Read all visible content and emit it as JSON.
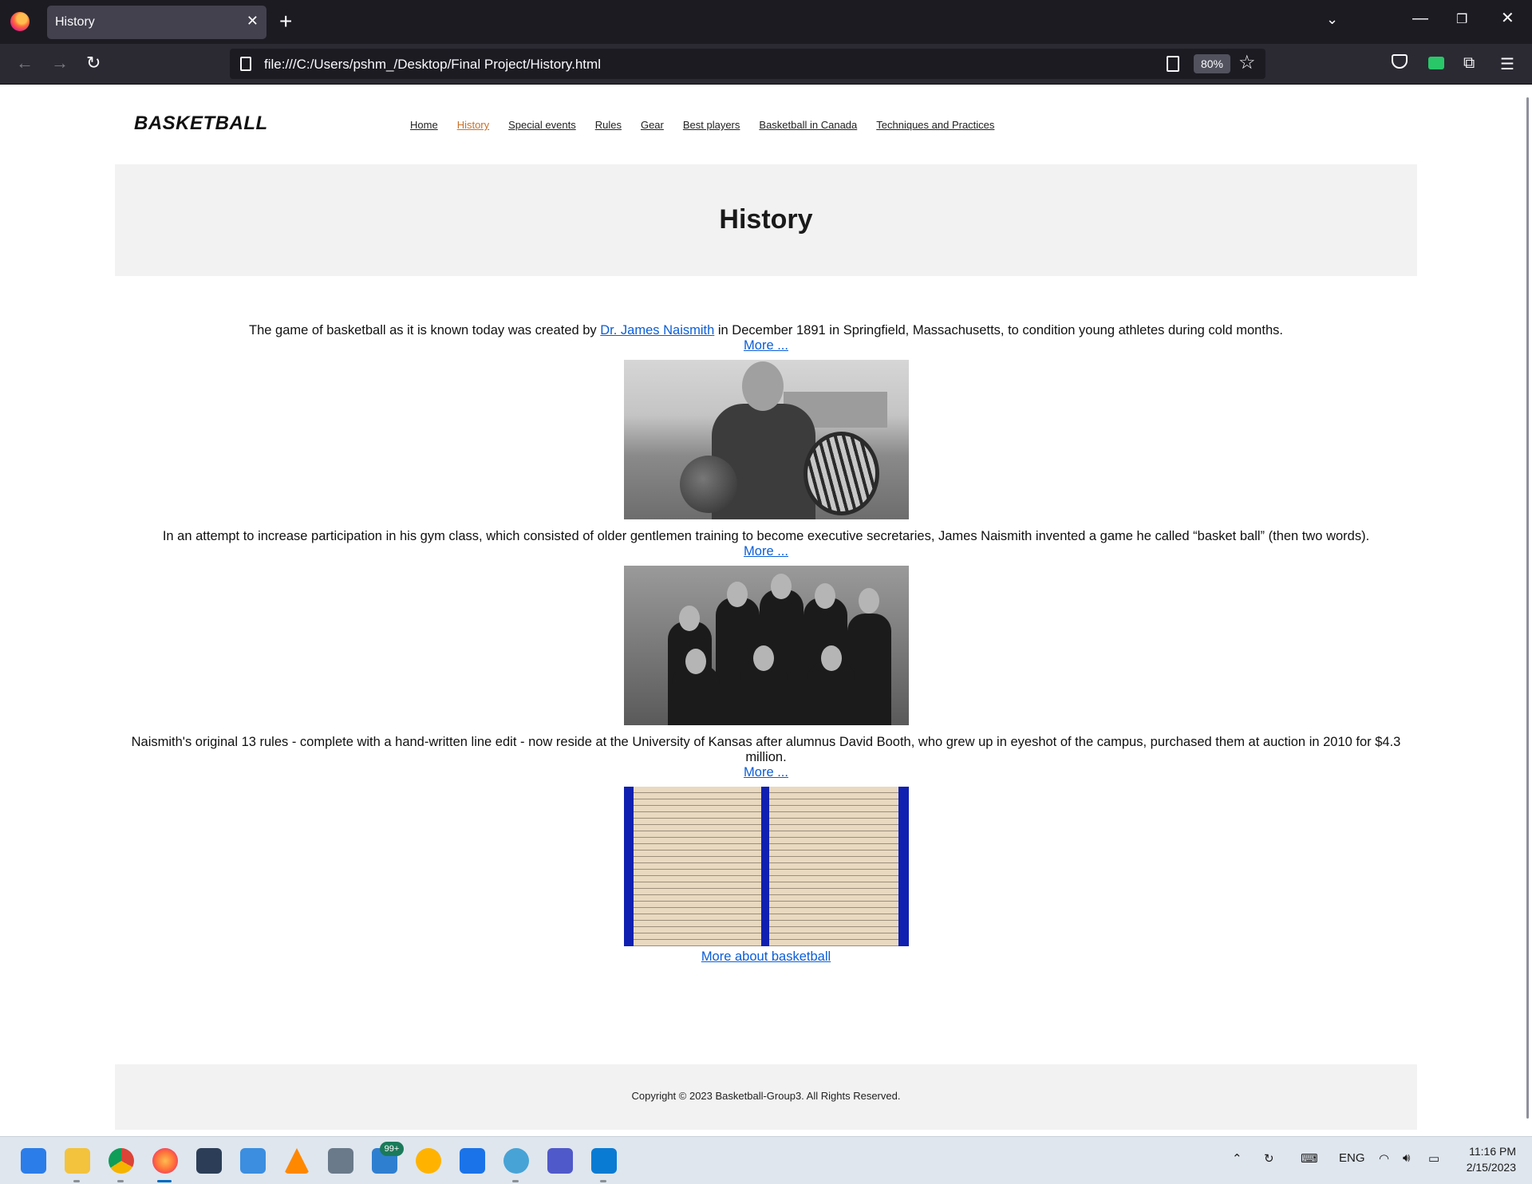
{
  "browser": {
    "tab_title": "History",
    "tab_close": "✕",
    "new_tab": "+",
    "url": "file:///C:/Users/pshm_/Desktop/Final Project/History.html",
    "zoom": "80%",
    "icons": [
      "firefox-logo",
      "back-arrow",
      "forward-arrow",
      "reload",
      "page-info",
      "reader-view",
      "bookmark-star",
      "pocket",
      "wallet",
      "extensions",
      "hamburger-menu"
    ]
  },
  "site": {
    "logo": "BASKETBALL",
    "nav": [
      {
        "label": "Home",
        "active": false
      },
      {
        "label": "History",
        "active": true
      },
      {
        "label": "Special events",
        "active": false
      },
      {
        "label": "Rules",
        "active": false
      },
      {
        "label": "Gear",
        "active": false
      },
      {
        "label": "Best players",
        "active": false
      },
      {
        "label": "Basketball in Canada",
        "active": false
      },
      {
        "label": "Techniques and Practices",
        "active": false
      }
    ],
    "accent_color": "#c8712a",
    "link_color": "#0b5ed7"
  },
  "hero": {
    "title": "History"
  },
  "content": {
    "p1_before": "The game of basketball as it is known today was created by ",
    "p1_link": "Dr. James Naismith",
    "p1_after": " in December 1891 in Springfield, Massachusetts, to condition young athletes during cold months.",
    "p2": "In an attempt to increase participation in his gym class, which consisted of older gentlemen training to become executive secretaries, James Naismith invented a game he called “basket ball” (then two words).",
    "p3": "Naismith's original 13 rules - complete with a hand-written line edit - now reside at the University of Kansas after alumnus David Booth, who grew up in eyeshot of the campus, purchased them at auction in 2010 for $4.3 million.",
    "more_label": "More ...",
    "more_about": "More about basketball"
  },
  "footer": {
    "copyright": "Copyright © 2023 Basketball-Group3. All Rights Reserved."
  },
  "taskbar": {
    "mail_badge": "99+",
    "language": "ENG",
    "time": "11:16 PM",
    "date": "2/15/2023"
  }
}
